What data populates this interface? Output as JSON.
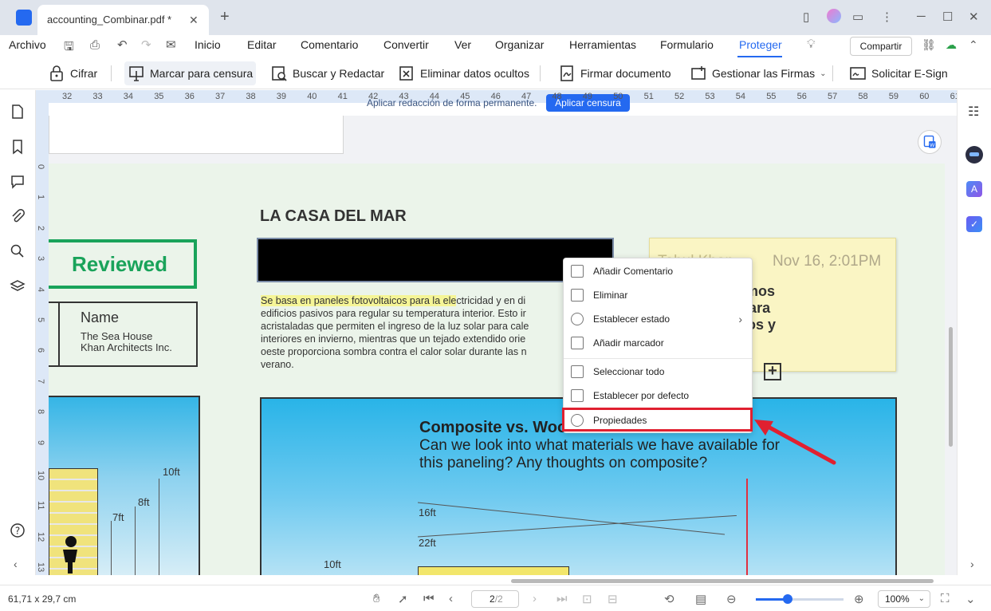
{
  "window": {
    "tab_title": "accounting_Combinar.pdf *",
    "tab_close": "✕",
    "new_tab": "+",
    "controls": {
      "minimize": "─",
      "maximize": "☐",
      "close": "✕"
    }
  },
  "menubar": {
    "file": "Archivo",
    "items": [
      "Inicio",
      "Editar",
      "Comentario",
      "Convertir",
      "Ver",
      "Organizar",
      "Herramientas",
      "Formulario",
      "Proteger"
    ],
    "active": "Proteger",
    "share": "Compartir"
  },
  "toolbar": {
    "cifrar": "Cifrar",
    "marcar": "Marcar para censura",
    "buscar": "Buscar y Redactar",
    "eliminar": "Eliminar datos ocultos",
    "firmar": "Firmar documento",
    "gestionar": "Gestionar las Firmas",
    "solicitar": "Solicitar E-Sign"
  },
  "ruler": {
    "h_ticks": [
      "32",
      "33",
      "34",
      "35",
      "36",
      "37",
      "38",
      "39",
      "40",
      "41",
      "42",
      "43",
      "44",
      "45",
      "46",
      "47",
      "48",
      "49",
      "50",
      "51",
      "52",
      "53",
      "54",
      "55",
      "56",
      "57",
      "58",
      "59",
      "60",
      "61"
    ],
    "v_ticks": [
      "0",
      "1",
      "2",
      "3",
      "4",
      "5",
      "6",
      "7",
      "8",
      "9",
      "10",
      "11",
      "12",
      "13"
    ]
  },
  "redaction_banner": {
    "text": "Aplicar redacción de forma permanente.",
    "button": "Aplicar censura"
  },
  "document": {
    "title": "LA CASA DEL MAR",
    "stamp": "Reviewed",
    "name_card": {
      "label": "Name",
      "line1": "The Sea House",
      "line2": "Khan Architects Inc."
    },
    "body_highlight": "Se basa en paneles fotovoltaicos para la ele",
    "body_rest": "ctricidad y en di\nedificios pasivos para regular su temperatura interior. Esto ir\nacristaladas que permiten el ingreso de la luz solar para cale\ninteriores en invierno, mientras que un tejado extendido orie\noeste proporciona sombra contra el calor solar durante las n\nverano.",
    "sticky": {
      "author": "Tabul Khan",
      "date": "Nov 16, 2:01PM",
      "text": "y bien, tengamos\nsta semana para\nde los números y\nalles."
    },
    "left_dims": {
      "d10": "10ft",
      "d8": "8ft",
      "d7": "7ft"
    },
    "photo": {
      "title": "Composite vs. Woo",
      "text": "Can we look into what materials we have available for this paneling? Any thoughts on composite?",
      "l16": "16ft",
      "l22": "22ft",
      "l10": "10ft"
    }
  },
  "context_menu": {
    "items": [
      "Añadir Comentario",
      "Eliminar",
      "Establecer estado",
      "Añadir marcador",
      "Seleccionar todo",
      "Establecer por defecto",
      "Propiedades"
    ],
    "submenu_arrow": "›"
  },
  "status": {
    "dimensions": "61,71 x 29,7 cm",
    "page_current": "2",
    "page_total": "/2",
    "zoom": "100%",
    "zoom_fraction": 0.36
  },
  "colors": {
    "accent": "#2469f0",
    "stamp_green": "#19a35a",
    "callout_red": "#e02030",
    "highlight": "#f5f596",
    "sticky": "#faf5c4"
  }
}
